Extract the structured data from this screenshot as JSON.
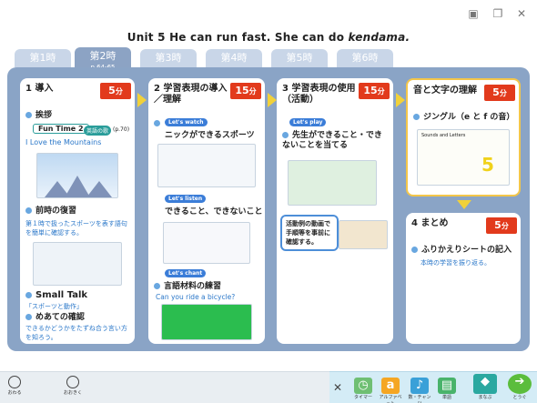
{
  "window": {
    "image_icon": "image-icon",
    "restore_icon": "restore-icon",
    "close_icon": "close-icon"
  },
  "title": {
    "prefix": "Unit 5",
    "text": "He can run fast.  She can do ",
    "italic": "kendama."
  },
  "tabs": [
    {
      "label": "第1時"
    },
    {
      "label": "第2時",
      "pages": "p.64-65",
      "active": true
    },
    {
      "label": "第3時"
    },
    {
      "label": "第4時"
    },
    {
      "label": "第5時"
    },
    {
      "label": "第6時"
    }
  ],
  "cards": {
    "c1": {
      "title": "1 導入",
      "minutes": "5",
      "unit": "分",
      "greeting": "挨拶",
      "fun_time": "Fun Time 2",
      "fun_badge": "英語の歌",
      "fun_page": "(p.70)",
      "song": "I Love the Mountains",
      "review": "前時の復習",
      "review_note": "第１時で扱ったスポーツを表す語句を簡単に確認する。",
      "small_talk": "Small Talk",
      "small_talk_sub": "「スポーツと動作」",
      "goal": "めあての確認",
      "goal_note": "できるかどうかをたずね合う言い方を知ろう。"
    },
    "c2": {
      "title": "2 学習表現の導入／理解",
      "minutes": "15",
      "unit": "分",
      "watch": "Let's watch",
      "item1": "ニックができるスポーツ",
      "listen": "Let's listen",
      "item2": "できること、できないこと",
      "chant": "Let's chant",
      "item3": "言語材料の練習",
      "item3_en": "Can you ride a bicycle?"
    },
    "c3": {
      "title": "3 学習表現の使用（活動）",
      "minutes": "15",
      "unit": "分",
      "play": "Let's play",
      "item1": "先生ができること・できないことを当てる",
      "bubble": "活動例の動画で手順等を事前に確認する。"
    },
    "c4": {
      "title": "音と文字の理解",
      "minutes": "5",
      "unit": "分",
      "item1": "ジングル（e と f の音）",
      "thumb_title": "Sounds and Letters"
    },
    "c5": {
      "title": "4 まとめ",
      "minutes": "5",
      "unit": "分",
      "item1": "ふりかえりシートの記入",
      "item1_note": "本時の学習を振り返る。"
    }
  },
  "bottom": {
    "end": "おわる",
    "zoom": "おおきく",
    "tools": [
      {
        "label": "タイマー",
        "icon": "timer-icon",
        "color": "#6fbf73"
      },
      {
        "label": "アルファベット",
        "icon": "alphabet-icon",
        "color": "#f5a623"
      },
      {
        "label": "数・チャンツ",
        "icon": "chant-icon",
        "color": "#3aa0d8"
      },
      {
        "label": "単語",
        "icon": "word-icon",
        "color": "#49b36b"
      }
    ],
    "learn": "まなぶ",
    "next": "とうぐ"
  }
}
